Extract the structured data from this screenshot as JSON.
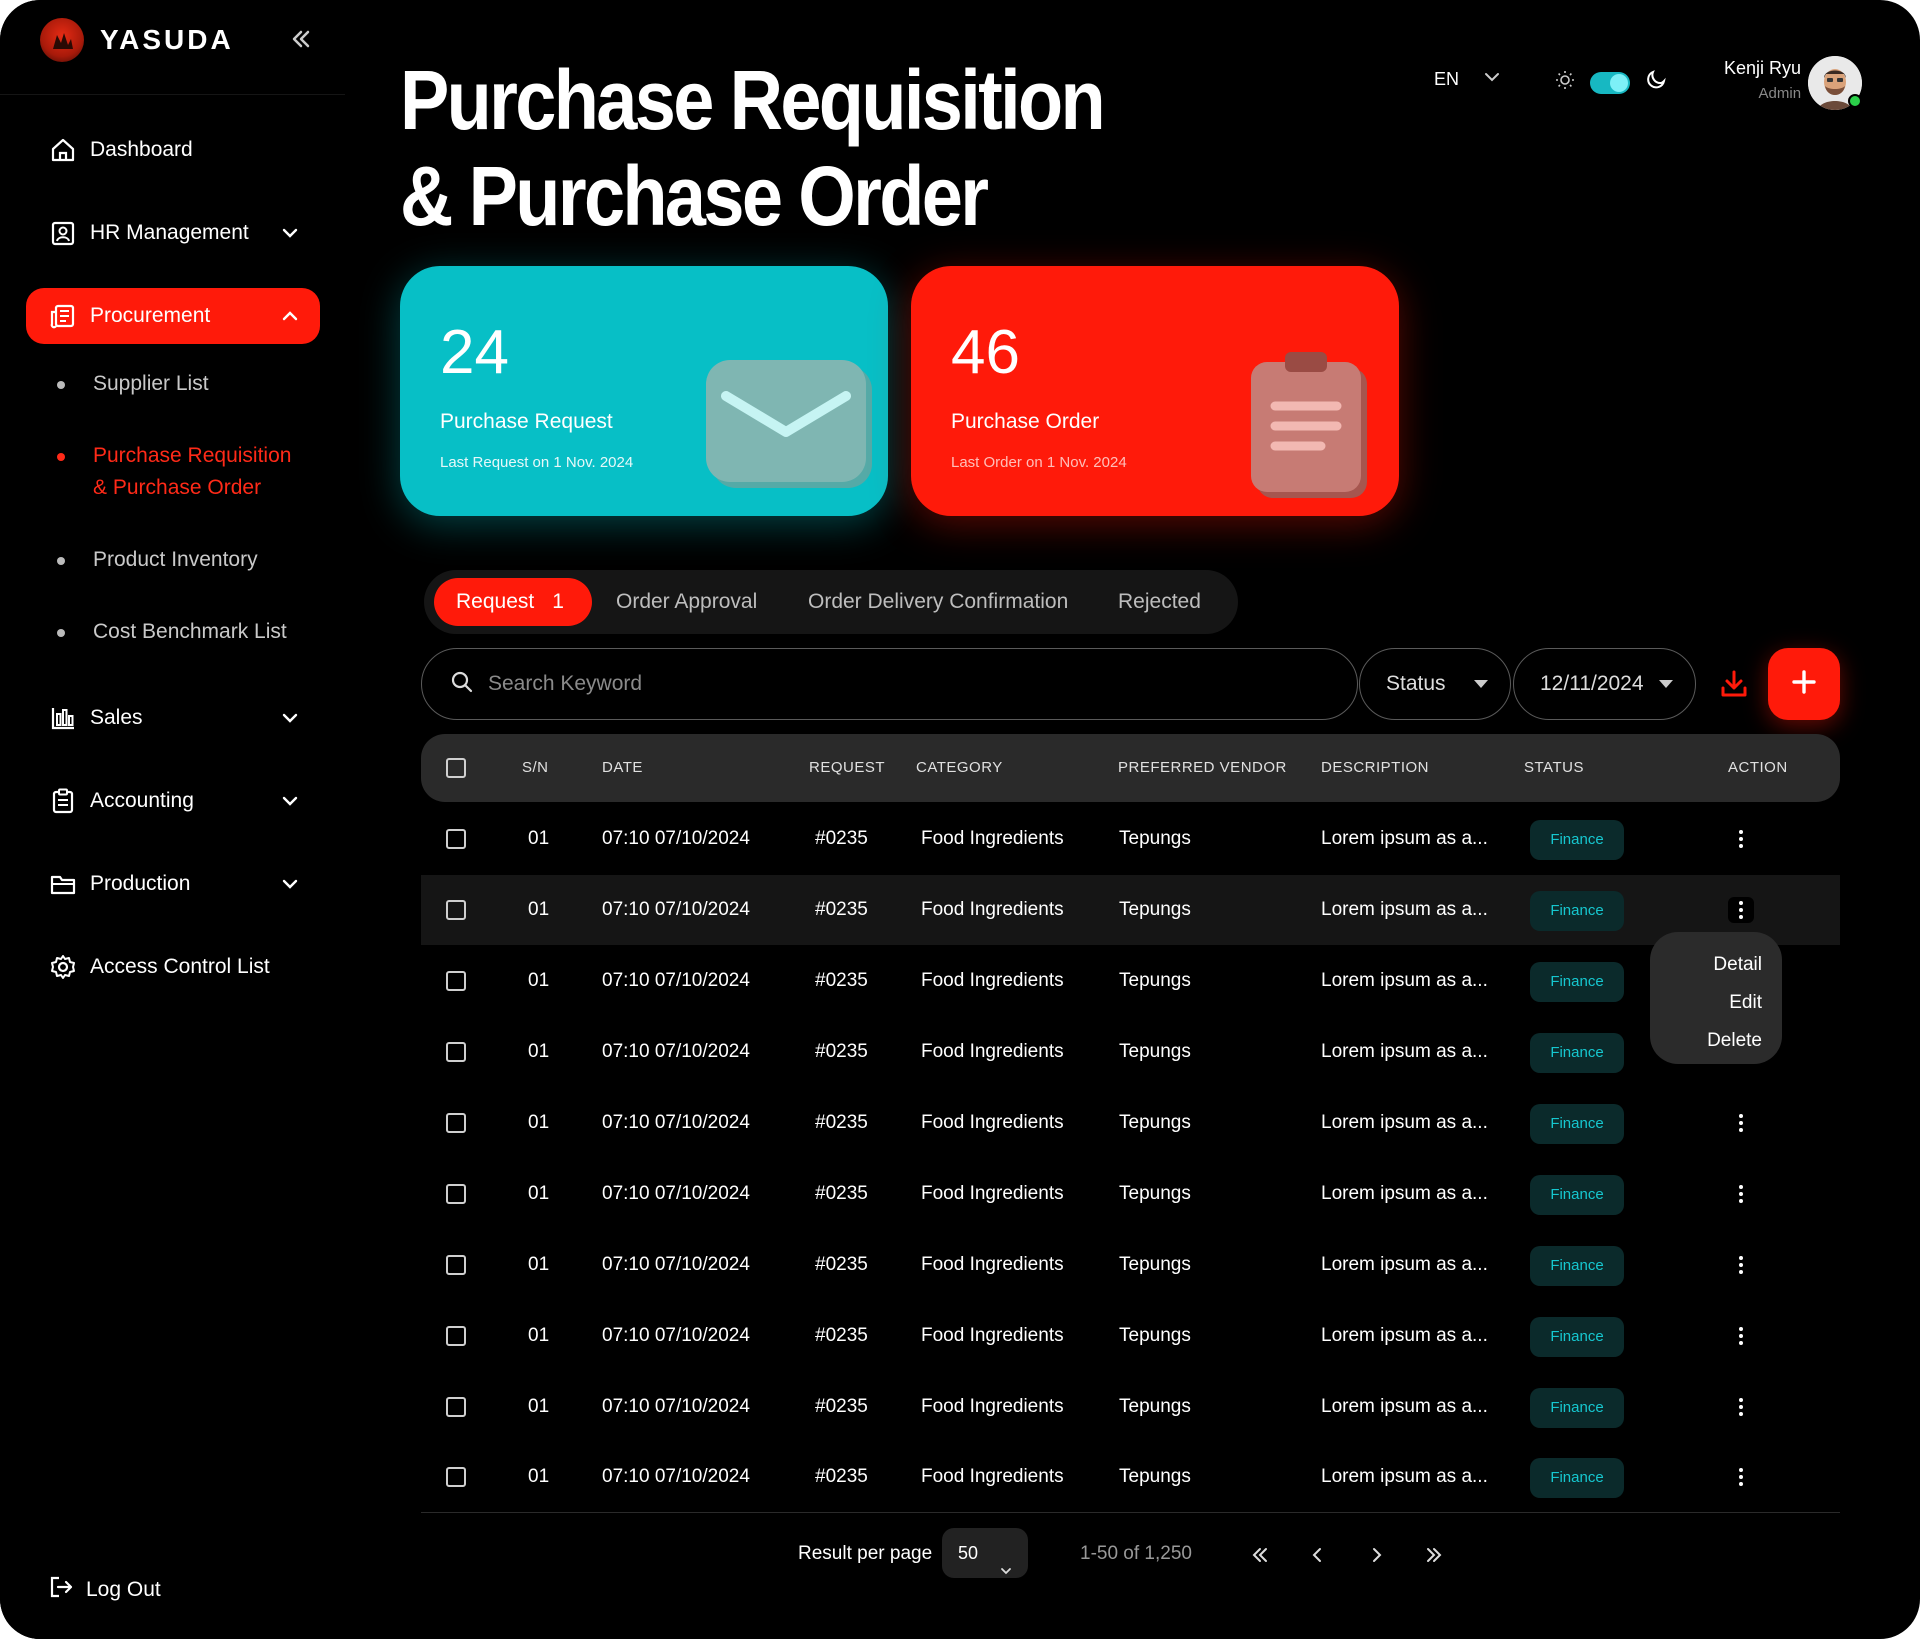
{
  "brand": {
    "name": "YASUDA"
  },
  "sidebar": {
    "items": [
      {
        "label": "Dashboard",
        "icon": "home-icon"
      },
      {
        "label": "HR Management",
        "icon": "id-badge-icon"
      },
      {
        "label": "Procurement",
        "icon": "newspaper-icon"
      },
      {
        "label": "Sales",
        "icon": "bar-chart-icon"
      },
      {
        "label": "Accounting",
        "icon": "clipboard-icon"
      },
      {
        "label": "Production",
        "icon": "folder-icon"
      },
      {
        "label": "Access Control List",
        "icon": "gear-icon"
      }
    ],
    "procurement_sub": [
      {
        "label": "Supplier List"
      },
      {
        "label_line1": "Purchase Requisition",
        "label_line2": "& Purchase Order"
      },
      {
        "label": "Product Inventory"
      },
      {
        "label": "Cost Benchmark List"
      }
    ],
    "logout": "Log Out"
  },
  "header": {
    "title_line1": "Purchase Requisition",
    "title_line2": "& Purchase Order",
    "language": "EN",
    "user_name": "Kenji Ryu",
    "user_role": "Admin"
  },
  "cards": {
    "request": {
      "count": "24",
      "label": "Purchase Request",
      "sub": "Last Request on 1 Nov. 2024"
    },
    "order": {
      "count": "46",
      "label": "Purchase Order",
      "sub": "Last Order on 1 Nov. 2024"
    }
  },
  "tabs": {
    "request": "Request",
    "request_count": "1",
    "approval": "Order Approval",
    "delivery": "Order Delivery Confirmation",
    "rejected": "Rejected"
  },
  "toolbar": {
    "search_placeholder": "Search Keyword",
    "status_label": "Status",
    "date_value": "12/11/2024"
  },
  "table": {
    "headers": {
      "sn": "S/N",
      "date": "DATE",
      "request": "REQUEST",
      "category": "CATEGORY",
      "vendor": "PREFERRED VENDOR",
      "description": "DESCRIPTION",
      "status": "STATUS",
      "action": "ACTION"
    },
    "rows": [
      {
        "sn": "01",
        "date": "07:10 07/10/2024",
        "request": "#0235",
        "category": "Food Ingredients",
        "vendor": "Tepungs",
        "description": "Lorem ipsum as a...",
        "status": "Finance"
      },
      {
        "sn": "01",
        "date": "07:10 07/10/2024",
        "request": "#0235",
        "category": "Food Ingredients",
        "vendor": "Tepungs",
        "description": "Lorem ipsum as a...",
        "status": "Finance"
      },
      {
        "sn": "01",
        "date": "07:10 07/10/2024",
        "request": "#0235",
        "category": "Food Ingredients",
        "vendor": "Tepungs",
        "description": "Lorem ipsum as a...",
        "status": "Finance"
      },
      {
        "sn": "01",
        "date": "07:10 07/10/2024",
        "request": "#0235",
        "category": "Food Ingredients",
        "vendor": "Tepungs",
        "description": "Lorem ipsum as a...",
        "status": "Finance"
      },
      {
        "sn": "01",
        "date": "07:10 07/10/2024",
        "request": "#0235",
        "category": "Food Ingredients",
        "vendor": "Tepungs",
        "description": "Lorem ipsum as a...",
        "status": "Finance"
      },
      {
        "sn": "01",
        "date": "07:10 07/10/2024",
        "request": "#0235",
        "category": "Food Ingredients",
        "vendor": "Tepungs",
        "description": "Lorem ipsum as a...",
        "status": "Finance"
      },
      {
        "sn": "01",
        "date": "07:10 07/10/2024",
        "request": "#0235",
        "category": "Food Ingredients",
        "vendor": "Tepungs",
        "description": "Lorem ipsum as a...",
        "status": "Finance"
      },
      {
        "sn": "01",
        "date": "07:10 07/10/2024",
        "request": "#0235",
        "category": "Food Ingredients",
        "vendor": "Tepungs",
        "description": "Lorem ipsum as a...",
        "status": "Finance"
      },
      {
        "sn": "01",
        "date": "07:10 07/10/2024",
        "request": "#0235",
        "category": "Food Ingredients",
        "vendor": "Tepungs",
        "description": "Lorem ipsum as a...",
        "status": "Finance"
      },
      {
        "sn": "01",
        "date": "07:10 07/10/2024",
        "request": "#0235",
        "category": "Food Ingredients",
        "vendor": "Tepungs",
        "description": "Lorem ipsum as a...",
        "status": "Finance"
      }
    ]
  },
  "action_menu": {
    "detail": "Detail",
    "edit": "Edit",
    "delete": "Delete"
  },
  "pagination": {
    "per_page_label": "Result per page",
    "per_page_value": "50",
    "range": "1-50 of 1,250"
  },
  "colors": {
    "accent_red": "#ff1a0a",
    "accent_teal": "#07bfc6",
    "status_text": "#16c7cf"
  }
}
